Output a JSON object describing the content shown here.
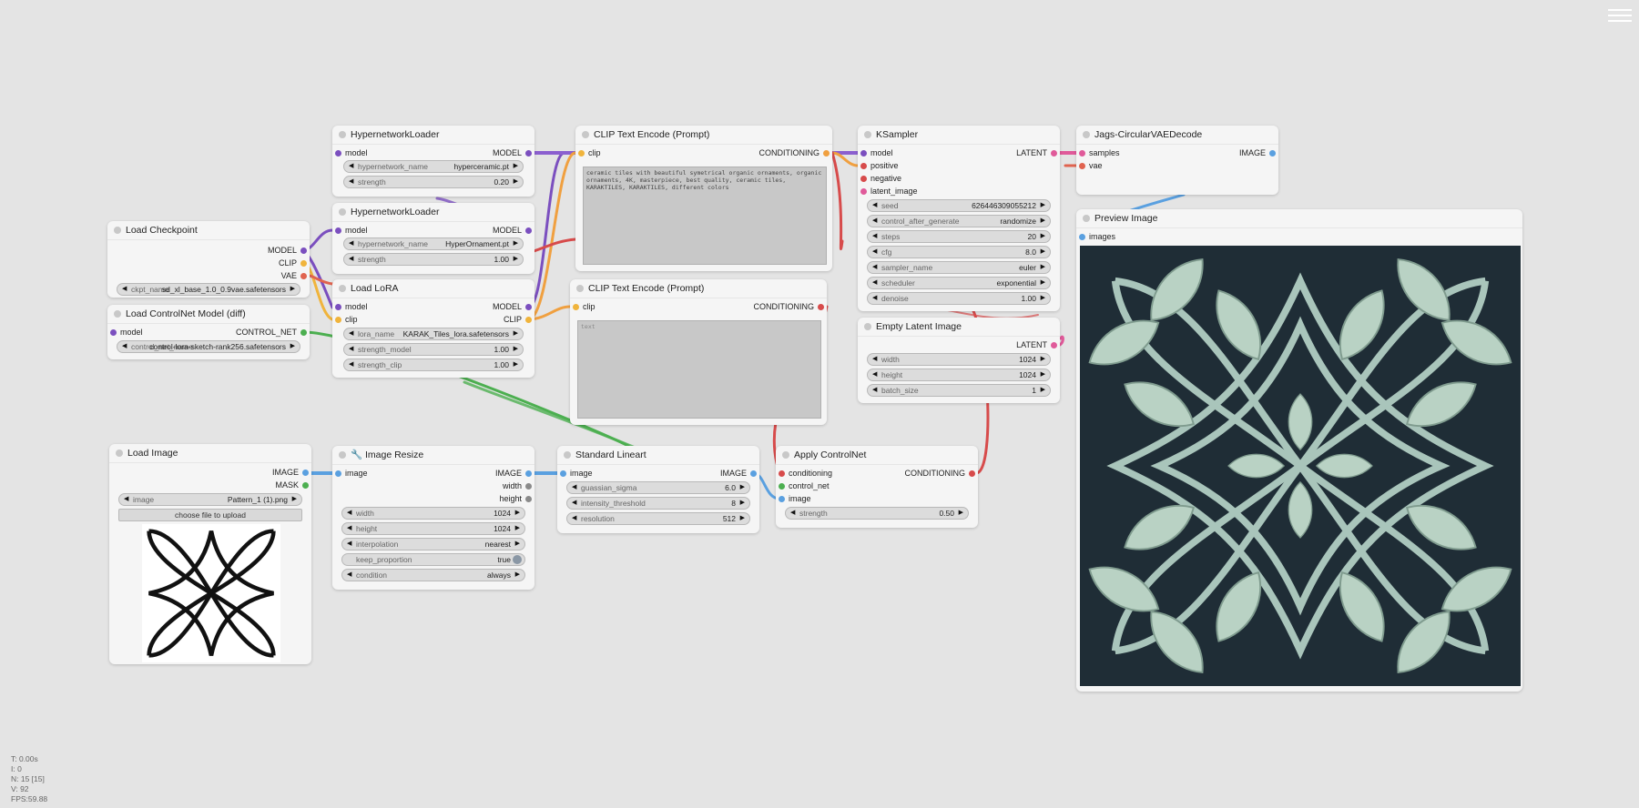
{
  "colors": {
    "model": "#7b4fbf",
    "clip": "#f0b43c",
    "vae": "#e0634f",
    "conditioning": "#f0a040",
    "latent": "#e05a9a",
    "image": "#5aa0e0",
    "control_net": "#4caf50",
    "red_link": "#d74b4b"
  },
  "nodes": {
    "hypernet1": {
      "title": "HypernetworkLoader",
      "input_model": "model",
      "output_model": "MODEL",
      "w_name_label": "hypernetwork_name",
      "w_name_value": "hyperceramic.pt",
      "w_strength_label": "strength",
      "w_strength_value": "0.20"
    },
    "hypernet2": {
      "title": "HypernetworkLoader",
      "input_model": "model",
      "output_model": "MODEL",
      "w_name_label": "hypernetwork_name",
      "w_name_value": "HyperOrnament.pt",
      "w_strength_label": "strength",
      "w_strength_value": "1.00"
    },
    "checkpoint": {
      "title": "Load Checkpoint",
      "out_model": "MODEL",
      "out_clip": "CLIP",
      "out_vae": "VAE",
      "w_ckpt_label": "ckpt_name",
      "w_ckpt_value": "sd_xl_base_1.0_0.9vae.safetensors"
    },
    "controlnet_loader": {
      "title": "Load ControlNet Model (diff)",
      "in_model": "model",
      "out": "CONTROL_NET",
      "w_label": "control_net_name",
      "w_value": "control-lora-sketch-rank256.safetensors"
    },
    "lora": {
      "title": "Load LoRA",
      "in_model": "model",
      "in_clip": "clip",
      "out_model": "MODEL",
      "out_clip": "CLIP",
      "w_name_label": "lora_name",
      "w_name_value": "KARAK_Tiles_lora.safetensors",
      "w_sm_label": "strength_model",
      "w_sm_value": "1.00",
      "w_sc_label": "strength_clip",
      "w_sc_value": "1.00"
    },
    "clip_pos": {
      "title": "CLIP Text Encode (Prompt)",
      "in_clip": "clip",
      "out": "CONDITIONING",
      "text": "ceramic tiles with beautiful symetrical organic ornaments, organic ornaments, 4K, masterpiece, best quality, ceramic tiles, KARAKTILES, KARAKTILES, different colors"
    },
    "clip_neg": {
      "title": "CLIP Text Encode (Prompt)",
      "in_clip": "clip",
      "out": "CONDITIONING",
      "placeholder": "text"
    },
    "ksampler": {
      "title": "KSampler",
      "in_model": "model",
      "in_positive": "positive",
      "in_negative": "negative",
      "in_latent": "latent_image",
      "out": "LATENT",
      "widgets": [
        {
          "label": "seed",
          "value": "626446309055212"
        },
        {
          "label": "control_after_generate",
          "value": "randomize"
        },
        {
          "label": "steps",
          "value": "20"
        },
        {
          "label": "cfg",
          "value": "8.0"
        },
        {
          "label": "sampler_name",
          "value": "euler"
        },
        {
          "label": "scheduler",
          "value": "exponential"
        },
        {
          "label": "denoise",
          "value": "1.00"
        }
      ]
    },
    "empty_latent": {
      "title": "Empty Latent Image",
      "out": "LATENT",
      "widgets": [
        {
          "label": "width",
          "value": "1024"
        },
        {
          "label": "height",
          "value": "1024"
        },
        {
          "label": "batch_size",
          "value": "1"
        }
      ]
    },
    "vae_decode": {
      "title": "Jags-CircularVAEDecode",
      "in_samples": "samples",
      "in_vae": "vae",
      "out": "IMAGE"
    },
    "preview": {
      "title": "Preview Image",
      "in_images": "images"
    },
    "load_image": {
      "title": "Load Image",
      "out_image": "IMAGE",
      "out_mask": "MASK",
      "w_label": "image",
      "w_value": "Pattern_1 (1).png",
      "upload": "choose file to upload"
    },
    "resize": {
      "title": "🔧 Image Resize",
      "in_image": "image",
      "out_image": "IMAGE",
      "out_width": "width",
      "out_height": "height",
      "widgets": [
        {
          "label": "width",
          "value": "1024"
        },
        {
          "label": "height",
          "value": "1024"
        },
        {
          "label": "interpolation",
          "value": "nearest"
        },
        {
          "label": "keep_proportion",
          "value": "true"
        },
        {
          "label": "condition",
          "value": "always"
        }
      ]
    },
    "lineart": {
      "title": "Standard Lineart",
      "in_image": "image",
      "out": "IMAGE",
      "widgets": [
        {
          "label": "guassian_sigma",
          "value": "6.0"
        },
        {
          "label": "intensity_threshold",
          "value": "8"
        },
        {
          "label": "resolution",
          "value": "512"
        }
      ]
    },
    "apply_cn": {
      "title": "Apply ControlNet",
      "in_cond": "conditioning",
      "in_cn": "control_net",
      "in_image": "image",
      "out": "CONDITIONING",
      "w_label": "strength",
      "w_value": "0.50"
    }
  },
  "stats": {
    "t": "T: 0.00s",
    "i": "I: 0",
    "n": "N: 15 [15]",
    "v": "V: 92",
    "fps": "FPS:59.88"
  }
}
